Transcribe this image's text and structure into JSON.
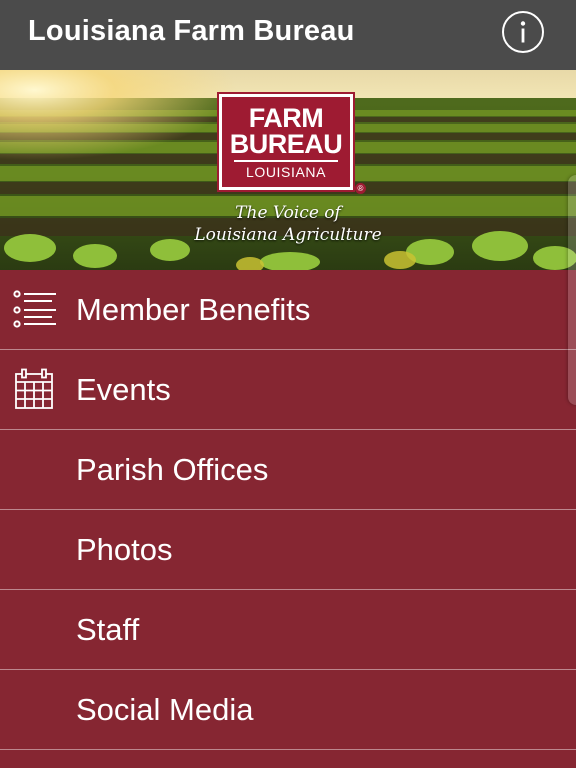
{
  "appbar": {
    "title": "Louisiana Farm Bureau",
    "info_icon": "info-circle-icon"
  },
  "hero": {
    "logo": {
      "line1": "FARM",
      "line2": "BUREAU",
      "line3": "LOUISIANA",
      "registered": "®"
    },
    "tagline_line1": "The Voice of",
    "tagline_line2": "Louisiana Agriculture"
  },
  "menu": {
    "items": [
      {
        "label": "Member Benefits",
        "icon": "list-icon"
      },
      {
        "label": "Events",
        "icon": "calendar-icon"
      },
      {
        "label": "Parish Offices",
        "icon": ""
      },
      {
        "label": "Photos",
        "icon": ""
      },
      {
        "label": "Staff",
        "icon": ""
      },
      {
        "label": "Social Media",
        "icon": ""
      }
    ]
  },
  "colors": {
    "appbar": "#4b4b4b",
    "menu_background": "#862632",
    "logo_red": "#9e1b32",
    "text": "#ffffff"
  }
}
